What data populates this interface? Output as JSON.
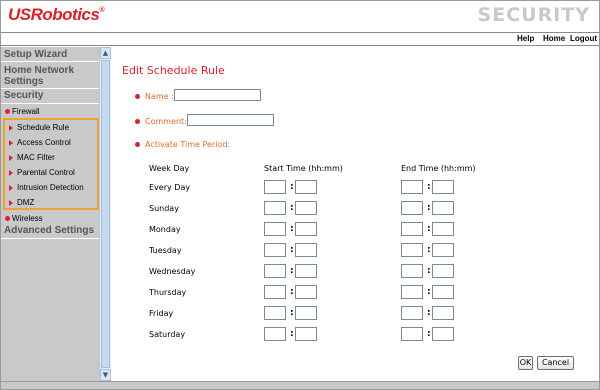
{
  "brand": {
    "logo_text": "USRobotics",
    "logo_mark": "®"
  },
  "header": {
    "section_title": "SECURITY"
  },
  "topnav": {
    "help": "Help",
    "home": "Home",
    "logout": "Logout"
  },
  "sidebar": {
    "setup_wizard": "Setup Wizard",
    "home_network_line1": "Home Network",
    "home_network_line2": "Settings",
    "security": "Security",
    "firewall": "Firewall",
    "firewall_items": [
      "Schedule Rule",
      "Access Control",
      "MAC Filter",
      "Parental Control",
      "Intrusion Detection",
      "DMZ"
    ],
    "wireless": "Wireless",
    "advanced_settings": "Advanced Settings"
  },
  "scroll": {
    "up_icon": "▲",
    "down_icon": "▼"
  },
  "form": {
    "title": "Edit Schedule Rule",
    "name_label": "Name :",
    "name_value": "",
    "comment_label": "Comment:",
    "comment_value": "",
    "activate_label": "Activate Time Period:",
    "col_weekday": "Week Day",
    "col_start": "Start Time (hh:mm)",
    "col_end": "End Time (hh:mm)",
    "colon": ":",
    "days": [
      "Every Day",
      "Sunday",
      "Monday",
      "Tuesday",
      "Wednesday",
      "Thursday",
      "Friday",
      "Saturday"
    ],
    "ok_label": "OK",
    "cancel_label": "Cancel"
  },
  "colors": {
    "brand_red": "#d8232a",
    "label_orange": "#e06a2a",
    "sidebar_gray": "#c9c9c9",
    "highlight_orange": "#f0a034"
  }
}
